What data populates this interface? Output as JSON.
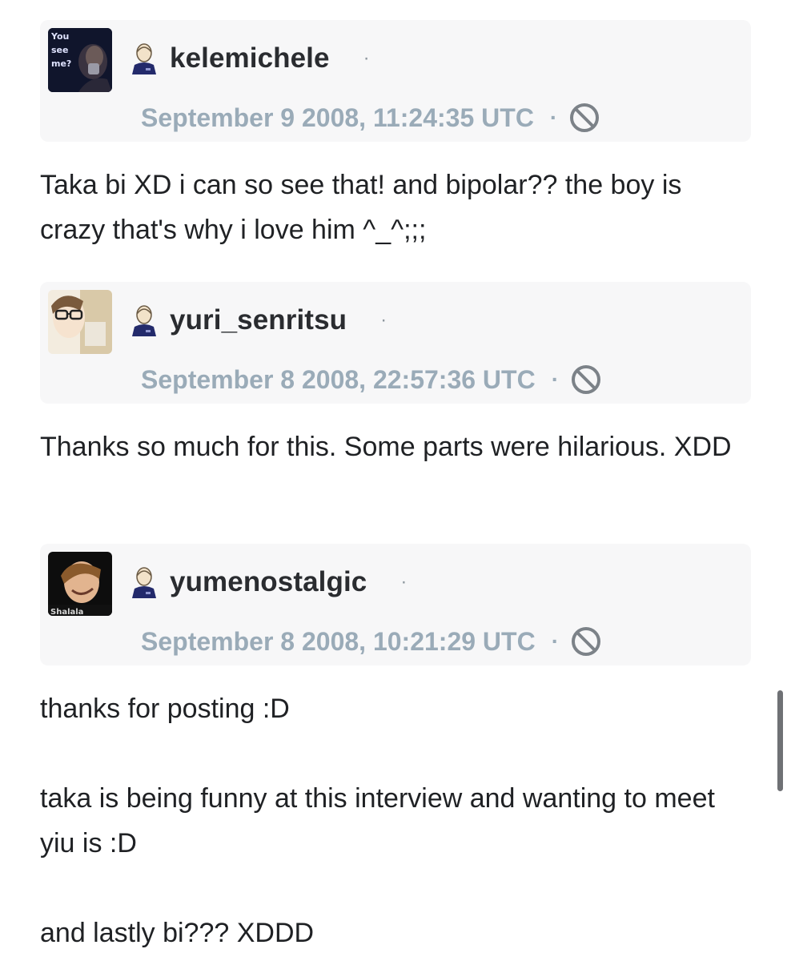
{
  "comments": [
    {
      "username": "kelemichele",
      "menu_dot": "·",
      "timestamp": "September 9 2008, 11:24:35 UTC",
      "separator": "·",
      "avatar_text": [
        "You",
        "see",
        "me?"
      ],
      "body": [
        "Taka bi XD i can so see that! and bipolar?? the boy is crazy that's why i love him ^_^;;;"
      ]
    },
    {
      "username": "yuri_senritsu",
      "menu_dot": "·",
      "timestamp": "September 8 2008, 22:57:36 UTC",
      "separator": "·",
      "body": [
        "Thanks so much for this. Some parts were hilarious. XDD"
      ]
    },
    {
      "username": "yumenostalgic",
      "menu_dot": "·",
      "timestamp": "September 8 2008, 10:21:29 UTC",
      "separator": "·",
      "avatar_text": [
        "Shalala"
      ],
      "body": [
        "thanks for posting :D",
        "taka is being funny at this interview and wanting to meet yiu is :D",
        "and lastly bi??? XDDD"
      ]
    }
  ],
  "icons": {
    "user": "user-icon",
    "block": "block-icon",
    "menu": "more-dot-icon"
  },
  "colors": {
    "card_bg": "#f7f7f8",
    "date": "#9aabb8",
    "username": "#2a2c30",
    "body": "#1f2124",
    "user_icon_body": "#232a6b"
  }
}
